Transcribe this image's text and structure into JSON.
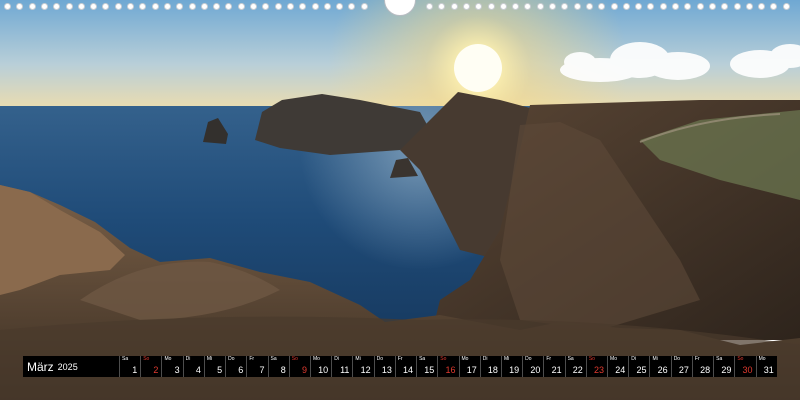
{
  "calendar": {
    "month": "März",
    "year": "2025",
    "days": [
      {
        "dow": "Sa",
        "num": "1"
      },
      {
        "dow": "So",
        "num": "2",
        "weekend": true
      },
      {
        "dow": "Mo",
        "num": "3"
      },
      {
        "dow": "Di",
        "num": "4"
      },
      {
        "dow": "Mi",
        "num": "5"
      },
      {
        "dow": "Do",
        "num": "6"
      },
      {
        "dow": "Fr",
        "num": "7"
      },
      {
        "dow": "Sa",
        "num": "8"
      },
      {
        "dow": "So",
        "num": "9",
        "weekend": true
      },
      {
        "dow": "Mo",
        "num": "10"
      },
      {
        "dow": "Di",
        "num": "11"
      },
      {
        "dow": "Mi",
        "num": "12"
      },
      {
        "dow": "Do",
        "num": "13"
      },
      {
        "dow": "Fr",
        "num": "14"
      },
      {
        "dow": "Sa",
        "num": "15"
      },
      {
        "dow": "So",
        "num": "16",
        "weekend": true
      },
      {
        "dow": "Mo",
        "num": "17"
      },
      {
        "dow": "Di",
        "num": "18"
      },
      {
        "dow": "Mi",
        "num": "19"
      },
      {
        "dow": "Do",
        "num": "20"
      },
      {
        "dow": "Fr",
        "num": "21"
      },
      {
        "dow": "Sa",
        "num": "22"
      },
      {
        "dow": "So",
        "num": "23",
        "weekend": true
      },
      {
        "dow": "Mo",
        "num": "24"
      },
      {
        "dow": "Di",
        "num": "25"
      },
      {
        "dow": "Mi",
        "num": "26"
      },
      {
        "dow": "Do",
        "num": "27"
      },
      {
        "dow": "Fr",
        "num": "28"
      },
      {
        "dow": "Sa",
        "num": "29"
      },
      {
        "dow": "So",
        "num": "30",
        "weekend": true
      },
      {
        "dow": "Mo",
        "num": "31"
      }
    ]
  },
  "colors": {
    "weekend": "#e03a2f",
    "bar": "#000000",
    "sea": "#1f4d7a",
    "sky": "#9cc3de",
    "sun": "#fff6c8",
    "cliff": "#4e3d2f"
  },
  "photo_subject": "coastal-cliffs-sunset"
}
